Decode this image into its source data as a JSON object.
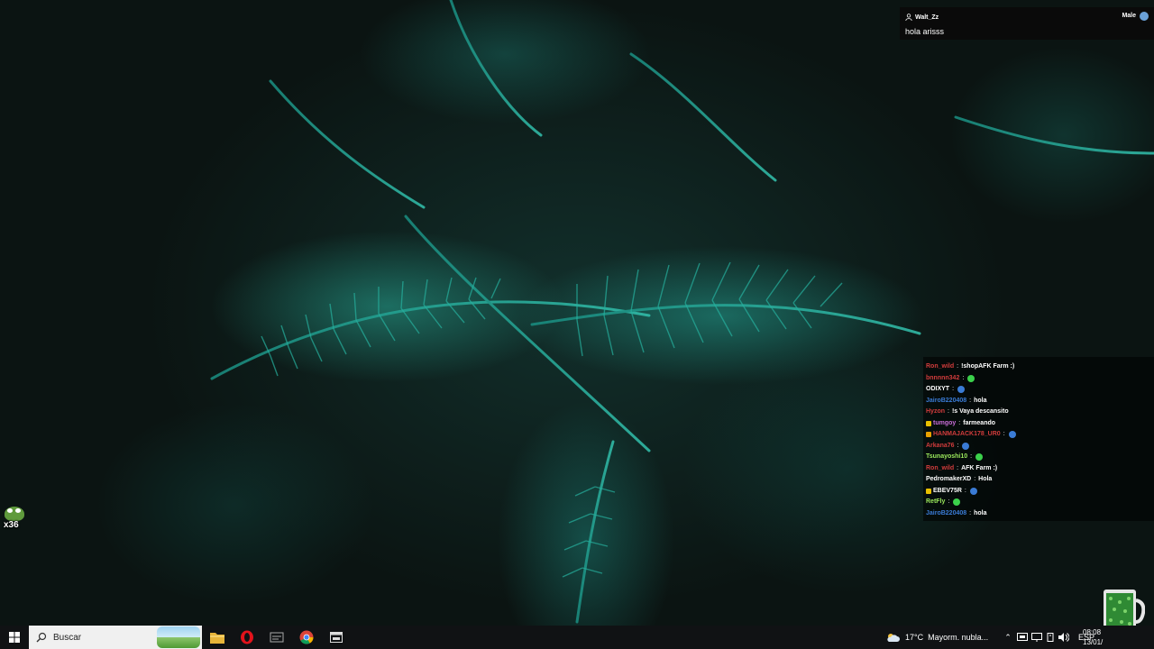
{
  "notification": {
    "username": "Walt_Zz",
    "gender": "Male",
    "message": "hola arisss",
    "icons": [
      "user-icon",
      "gender-avatar-icon"
    ]
  },
  "chat": {
    "lines": [
      {
        "name": "Ron_wild",
        "color": "#d23c3c",
        "text": "!shopAFK Farm :)",
        "emote": ""
      },
      {
        "name": "bnnnnn342",
        "color": "#d23c3c",
        "text": "",
        "emote": "#3bd14b"
      },
      {
        "name": "ODIXYT",
        "color": "#ffffff",
        "text": "",
        "emote": "#3a7bd5"
      },
      {
        "name": "JairoB220408",
        "color": "#3a7bd5",
        "text": "hola",
        "emote": ""
      },
      {
        "name": "Hyzon",
        "color": "#d23c3c",
        "text": "!s Vaya descansito",
        "emote": ""
      },
      {
        "name": "tumgoy",
        "color": "#c86dd7",
        "text": "farmeando",
        "emote": "",
        "badge": "#e8c000"
      },
      {
        "name": "HANMAJACK178_UR0",
        "color": "#d23c3c",
        "text": "",
        "emote": "#3a7bd5",
        "badge": "#e8a000"
      },
      {
        "name": "Arkana76",
        "color": "#d23c3c",
        "text": "",
        "emote": "#3a7bd5"
      },
      {
        "name": "Tsunayoshi10",
        "color": "#9be85c",
        "text": "",
        "emote": "#3bd14b"
      },
      {
        "name": "Ron_wild",
        "color": "#d23c3c",
        "text": "AFK Farm :)",
        "emote": ""
      },
      {
        "name": "PedromakerXD",
        "color": "#ffffff",
        "text": "Hola",
        "emote": ""
      },
      {
        "name": "EBEV75R",
        "color": "#ffffff",
        "text": "",
        "emote": "#3a7bd5",
        "badge": "#e8c000"
      },
      {
        "name": "RetFly",
        "color": "#9be85c",
        "text": "",
        "emote": "#3bd14b"
      },
      {
        "name": "JairoB220408",
        "color": "#3a7bd5",
        "text": "hola",
        "emote": ""
      }
    ]
  },
  "desktop_widget": {
    "count": "x36",
    "icon": "pepe-frog-icon"
  },
  "taskbar": {
    "search_placeholder": "Buscar",
    "apps": [
      "file-explorer-icon",
      "opera-icon",
      "taskbar-app-icon",
      "chrome-icon",
      "window-switch-icon"
    ],
    "weather": {
      "temp": "17°C",
      "desc": "Mayorm. nubla..."
    },
    "language": "ESP",
    "time": "08:08",
    "date": "13/01/"
  }
}
